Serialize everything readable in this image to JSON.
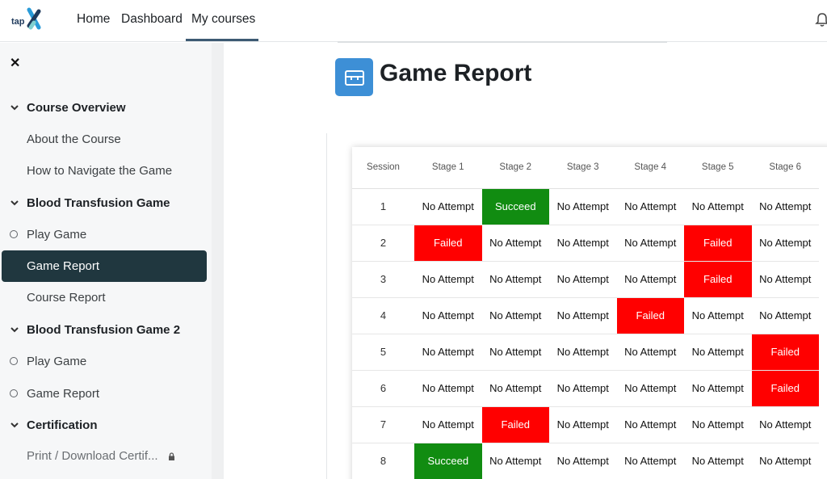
{
  "nav": {
    "logo_text": "tap",
    "links": [
      "Home",
      "Dashboard",
      "My courses"
    ],
    "active": "My courses"
  },
  "sidebar": {
    "sections": [
      {
        "label": "Course Overview"
      },
      {
        "label": "Blood Transfusion Game"
      },
      {
        "label": "Blood Transfusion Game 2"
      },
      {
        "label": "Certification"
      }
    ],
    "items": {
      "about": "About the Course",
      "navigate": "How to Navigate the Game",
      "play1": "Play Game",
      "report1": "Game Report",
      "course_report": "Course Report",
      "play2": "Play Game",
      "report2": "Game Report",
      "certificate": "Print / Download Certif..."
    }
  },
  "main": {
    "title": "Game Report",
    "table": {
      "headers": [
        "Session",
        "Stage 1",
        "Stage 2",
        "Stage 3",
        "Stage 4",
        "Stage 5",
        "Stage 6"
      ],
      "rows": [
        [
          "1",
          "No Attempt",
          "Succeed",
          "No Attempt",
          "No Attempt",
          "No Attempt",
          "No Attempt"
        ],
        [
          "2",
          "Failed",
          "No Attempt",
          "No Attempt",
          "No Attempt",
          "Failed",
          "No Attempt"
        ],
        [
          "3",
          "No Attempt",
          "No Attempt",
          "No Attempt",
          "No Attempt",
          "Failed",
          "No Attempt"
        ],
        [
          "4",
          "No Attempt",
          "No Attempt",
          "No Attempt",
          "Failed",
          "No Attempt",
          "No Attempt"
        ],
        [
          "5",
          "No Attempt",
          "No Attempt",
          "No Attempt",
          "No Attempt",
          "No Attempt",
          "Failed"
        ],
        [
          "6",
          "No Attempt",
          "No Attempt",
          "No Attempt",
          "No Attempt",
          "No Attempt",
          "Failed"
        ],
        [
          "7",
          "No Attempt",
          "Failed",
          "No Attempt",
          "No Attempt",
          "No Attempt",
          "No Attempt"
        ],
        [
          "8",
          "Succeed",
          "No Attempt",
          "No Attempt",
          "No Attempt",
          "No Attempt",
          "No Attempt"
        ]
      ]
    }
  },
  "colors": {
    "failed": "#ff0000",
    "succeed": "#118c11",
    "active_item": "#20373f",
    "title_icon": "#3d8fd6"
  },
  "icons": [
    "tap-logo-icon",
    "bell-icon",
    "close-icon",
    "chevron-down-icon",
    "circle-icon",
    "lock-icon",
    "box-icon"
  ]
}
